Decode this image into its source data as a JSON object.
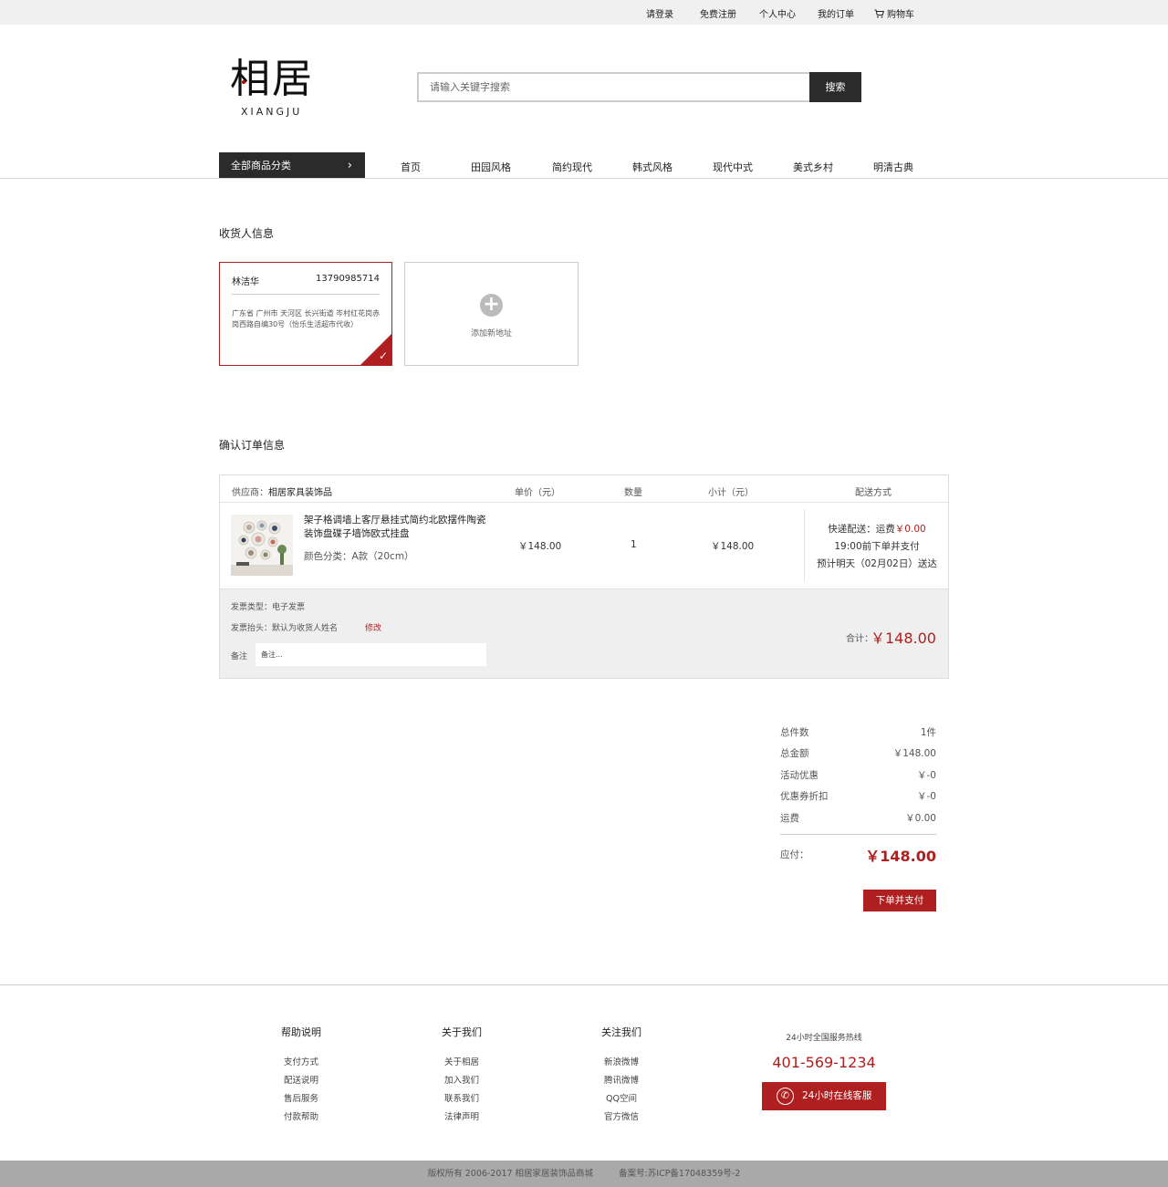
{
  "topbar": {
    "login": "请登录",
    "register": "免费注册",
    "user_center": "个人中心",
    "my_orders": "我的订单",
    "cart": "购物车"
  },
  "logo": {
    "chinese": "相居",
    "english": "XIANGJU"
  },
  "search": {
    "placeholder": "请输入关键字搜索",
    "button": "搜索"
  },
  "nav": {
    "all_categories": "全部商品分类",
    "items": [
      "首页",
      "田园风格",
      "简约现代",
      "韩式风格",
      "现代中式",
      "美式乡村",
      "明清古典"
    ]
  },
  "receiver": {
    "title": "收货人信息",
    "name": "林洁华",
    "phone": "13790985714",
    "address": "广东省 广州市 天河区 长兴街道 岑村红花岗赤岗西路自编30号（怡乐生活超市代收）",
    "add_new": "添加新地址"
  },
  "order": {
    "title": "确认订单信息",
    "headers": {
      "supplier_prefix": "供应商：",
      "supplier": "相居家具装饰品",
      "unit_price": "单价（元）",
      "qty": "数量",
      "subtotal": "小计（元）",
      "shipping": "配送方式"
    },
    "product": {
      "name": "架子格调墙上客厅悬挂式简约北欧摆件陶瓷装饰盘碟子墙饰欧式挂盘",
      "attr": "颜色分类：A款（20cm）",
      "price": "￥148.00",
      "qty": "1",
      "subtotal": "￥148.00"
    },
    "shipping": {
      "method": "快递配送：运费",
      "fee": "￥0.00",
      "line2": "19:00前下单并支付",
      "line3": "预计明天（02月02日）送达"
    },
    "invoice_type": "发票类型：电子发票",
    "invoice_title": "发票抬头：默认为收货人姓名",
    "edit": "修改",
    "note_label": "备注",
    "note_placeholder": "备注...",
    "total_label": "合计：",
    "total_value": "￥148.00"
  },
  "summary": {
    "rows": [
      {
        "k": "总件数",
        "v": "1件"
      },
      {
        "k": "总金额",
        "v": "￥148.00"
      },
      {
        "k": "活动优惠",
        "v": "￥-0"
      },
      {
        "k": "优惠券折扣",
        "v": "￥-0"
      },
      {
        "k": "运费",
        "v": "￥0.00"
      }
    ],
    "pay_label": "应付：",
    "pay_value": "￥148.00",
    "submit": "下单并支付"
  },
  "footer": {
    "cols": [
      {
        "title": "帮助说明",
        "items": [
          "支付方式",
          "配送说明",
          "售后服务",
          "付款帮助"
        ]
      },
      {
        "title": "关于我们",
        "items": [
          "关于相居",
          "加入我们",
          "联系我们",
          "法律声明"
        ]
      },
      {
        "title": "关注我们",
        "items": [
          "新浪微博",
          "腾讯微博",
          "QQ空间",
          "官方微信"
        ]
      }
    ],
    "hotline_label": "24小时全国服务热线",
    "hotline": "401-569-1234",
    "service": "24小时在线客服",
    "copyright": "版权所有 2006-2017 相居家居装饰品商城",
    "icp": "备案号:苏ICP备17048359号-2"
  },
  "colors": {
    "accent": "#b01f1f",
    "dark": "#2b2b2b"
  }
}
